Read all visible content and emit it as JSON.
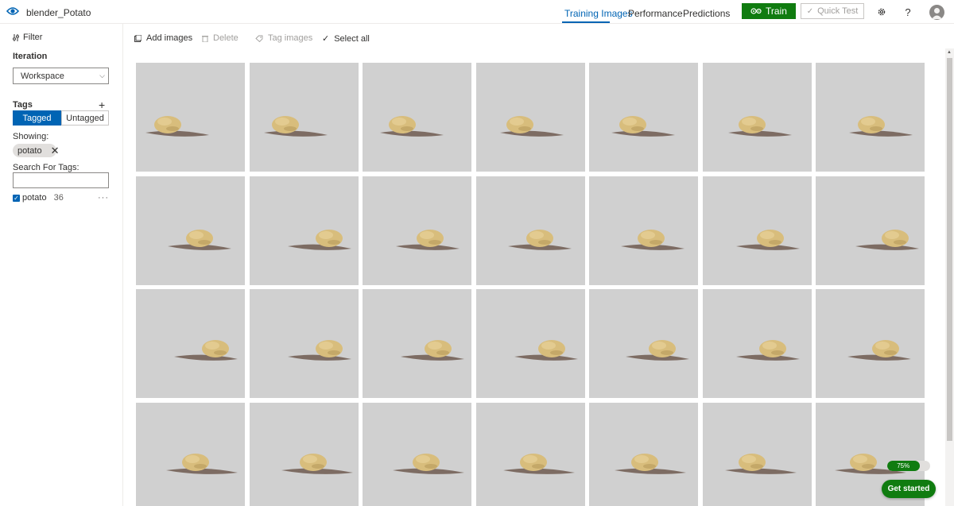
{
  "header": {
    "project_name": "blender_Potato",
    "tabs": [
      {
        "label": "Training Images",
        "active": true
      },
      {
        "label": "Performance",
        "active": false
      },
      {
        "label": "Predictions",
        "active": false
      }
    ],
    "train_label": "Train",
    "quick_test_label": "Quick Test",
    "accent_color": "#0064b4",
    "train_color": "#107c10"
  },
  "sidebar": {
    "filter_label": "Filter",
    "iteration_title": "Iteration",
    "iteration_selected": "Workspace",
    "tags_title": "Tags",
    "tagged_label": "Tagged",
    "untagged_label": "Untagged",
    "showing_label": "Showing:",
    "active_filter_chip": "potato",
    "search_tags_label": "Search For Tags:",
    "search_tags_value": "",
    "tags": [
      {
        "name": "potato",
        "count": "36",
        "checked": true
      }
    ]
  },
  "toolbar": {
    "add_images": "Add images",
    "delete": "Delete",
    "tag_images": "Tag images",
    "select_all": "Select all"
  },
  "images": {
    "rows": 4,
    "columns": 7,
    "subject": "potato"
  },
  "widget": {
    "progress": 75,
    "progress_label": "75%",
    "get_started_label": "Get started"
  }
}
